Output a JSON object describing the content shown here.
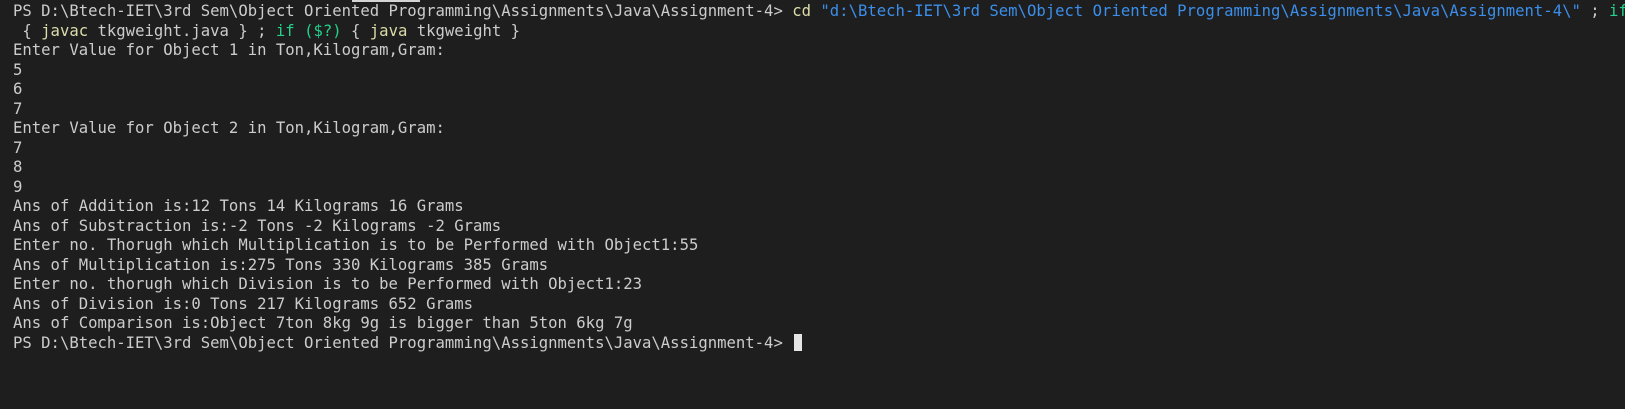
{
  "terminal": {
    "prompt": "PS D:\\Btech-IET\\3rd Sem\\Object Oriented Programming\\Assignments\\Java\\Assignment-4>",
    "command": {
      "cd": "cd",
      "path": "\"d:\\Btech-IET\\3rd Sem\\Object Oriented Programming\\Assignments\\Java\\Assignment-4\\\"",
      "sep1": " ; ",
      "if1": "if",
      "cond1": "($?)",
      "line2_lead": " { ",
      "javac": "javac",
      "javac_arg": " tkgweight.java } ; ",
      "if2": "if",
      "cond2": "($?)",
      "open2": " { ",
      "java": "java",
      "java_arg": " tkgweight }"
    },
    "output": [
      "Enter Value for Object 1 in Ton,Kilogram,Gram:",
      "5",
      "6",
      "7",
      "Enter Value for Object 2 in Ton,Kilogram,Gram:",
      "7",
      "8",
      "9",
      "Ans of Addition is:12 Tons 14 Kilograms 16 Grams",
      "Ans of Substraction is:-2 Tons -2 Kilograms -2 Grams",
      "Enter no. Thorugh which Multiplication is to be Performed with Object1:55",
      "Ans of Multiplication is:275 Tons 330 Kilograms 385 Grams",
      "Enter no. thorugh which Division is to be Performed with Object1:23",
      "Ans of Division is:0 Tons 217 Kilograms 652 Grams",
      "Ans of Comparison is:Object 7ton 8kg 9g is bigger than 5ton 6kg 7g"
    ],
    "final_prompt": "PS D:\\Btech-IET\\3rd Sem\\Object Oriented Programming\\Assignments\\Java\\Assignment-4>",
    "colors": {
      "background": "#1e1e1e",
      "text": "#cccccc",
      "command": "#dcdcaa",
      "string": "#3b8eea",
      "keyword": "#23d18b"
    }
  }
}
